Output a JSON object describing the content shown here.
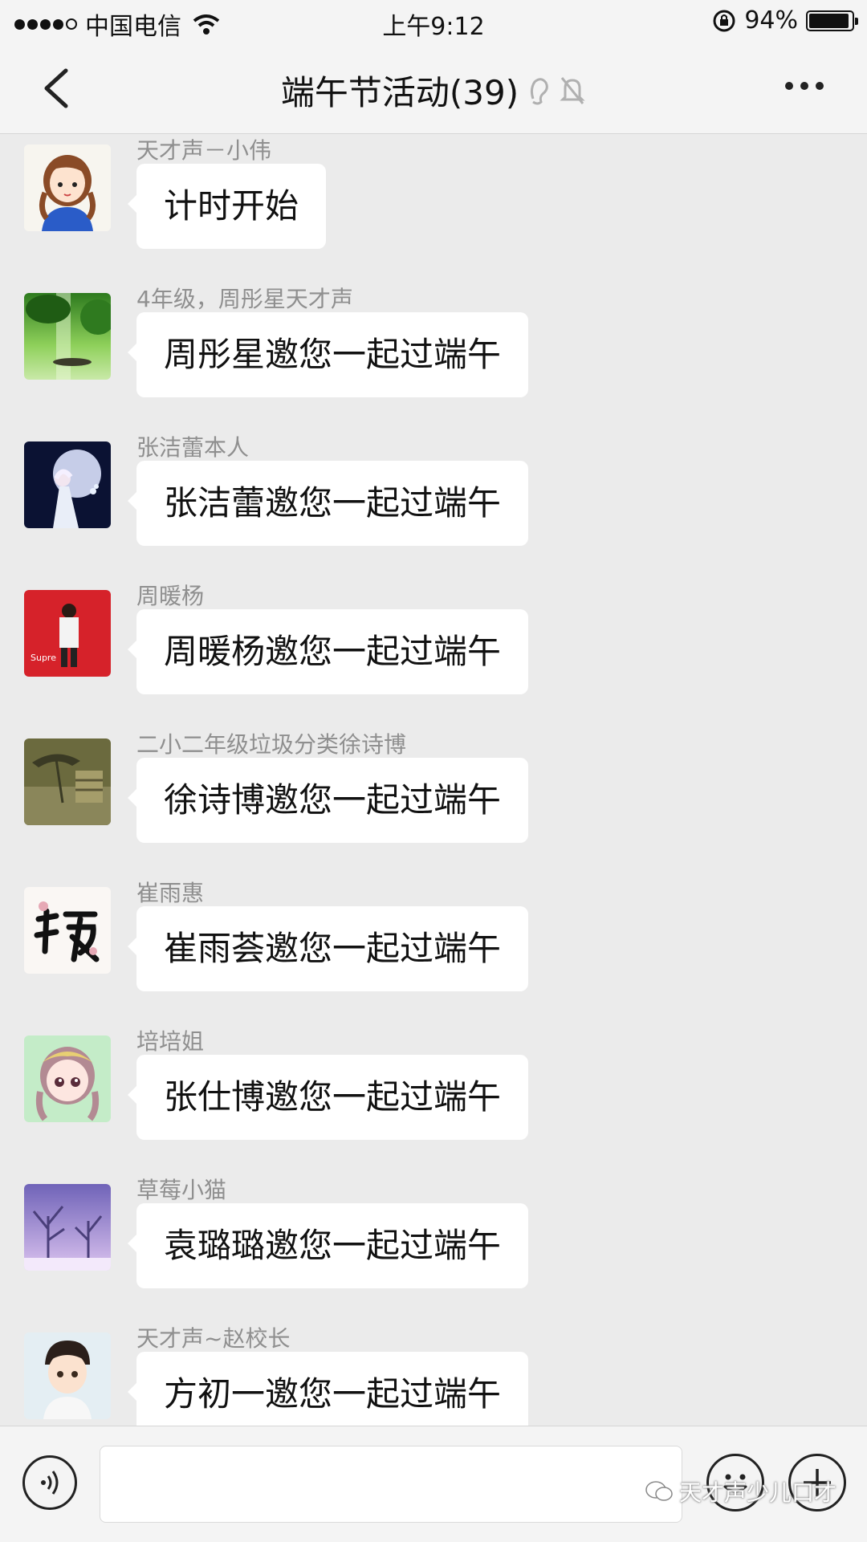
{
  "status_bar": {
    "carrier": "中国电信",
    "time": "上午9:12",
    "battery_percent": "94%",
    "battery_level": 0.94
  },
  "header": {
    "title": "端午节活动(39)",
    "back_icon": "chevron-left-icon",
    "more_icon": "more-dots-icon"
  },
  "messages": [
    {
      "sender": "天才声－小伟",
      "text": "计时开始"
    },
    {
      "sender": "4年级，周彤星天才声",
      "text": "周彤星邀您一起过端午"
    },
    {
      "sender": "张洁蕾本人",
      "text": "张洁蕾邀您一起过端午"
    },
    {
      "sender": "周暖杨",
      "text": "周暖杨邀您一起过端午"
    },
    {
      "sender": "二小二年级垃圾分类徐诗博",
      "text": "徐诗博邀您一起过端午"
    },
    {
      "sender": "崔雨惠",
      "text": "崔雨荟邀您一起过端午"
    },
    {
      "sender": "培培姐",
      "text": "张仕博邀您一起过端午"
    },
    {
      "sender": "草莓小猫",
      "text": "袁璐璐邀您一起过端午"
    },
    {
      "sender": "天才声~赵校长",
      "text": "方初一邀您一起过端午"
    }
  ],
  "input_bar": {
    "voice_icon": "voice-icon",
    "emoji_icon": "emoji-icon",
    "plus_icon": "plus-icon",
    "watermark": "天才声少儿口才"
  },
  "colors": {
    "background": "#ebebeb",
    "bubble": "#ffffff",
    "sender_text": "#8f8f8f"
  }
}
